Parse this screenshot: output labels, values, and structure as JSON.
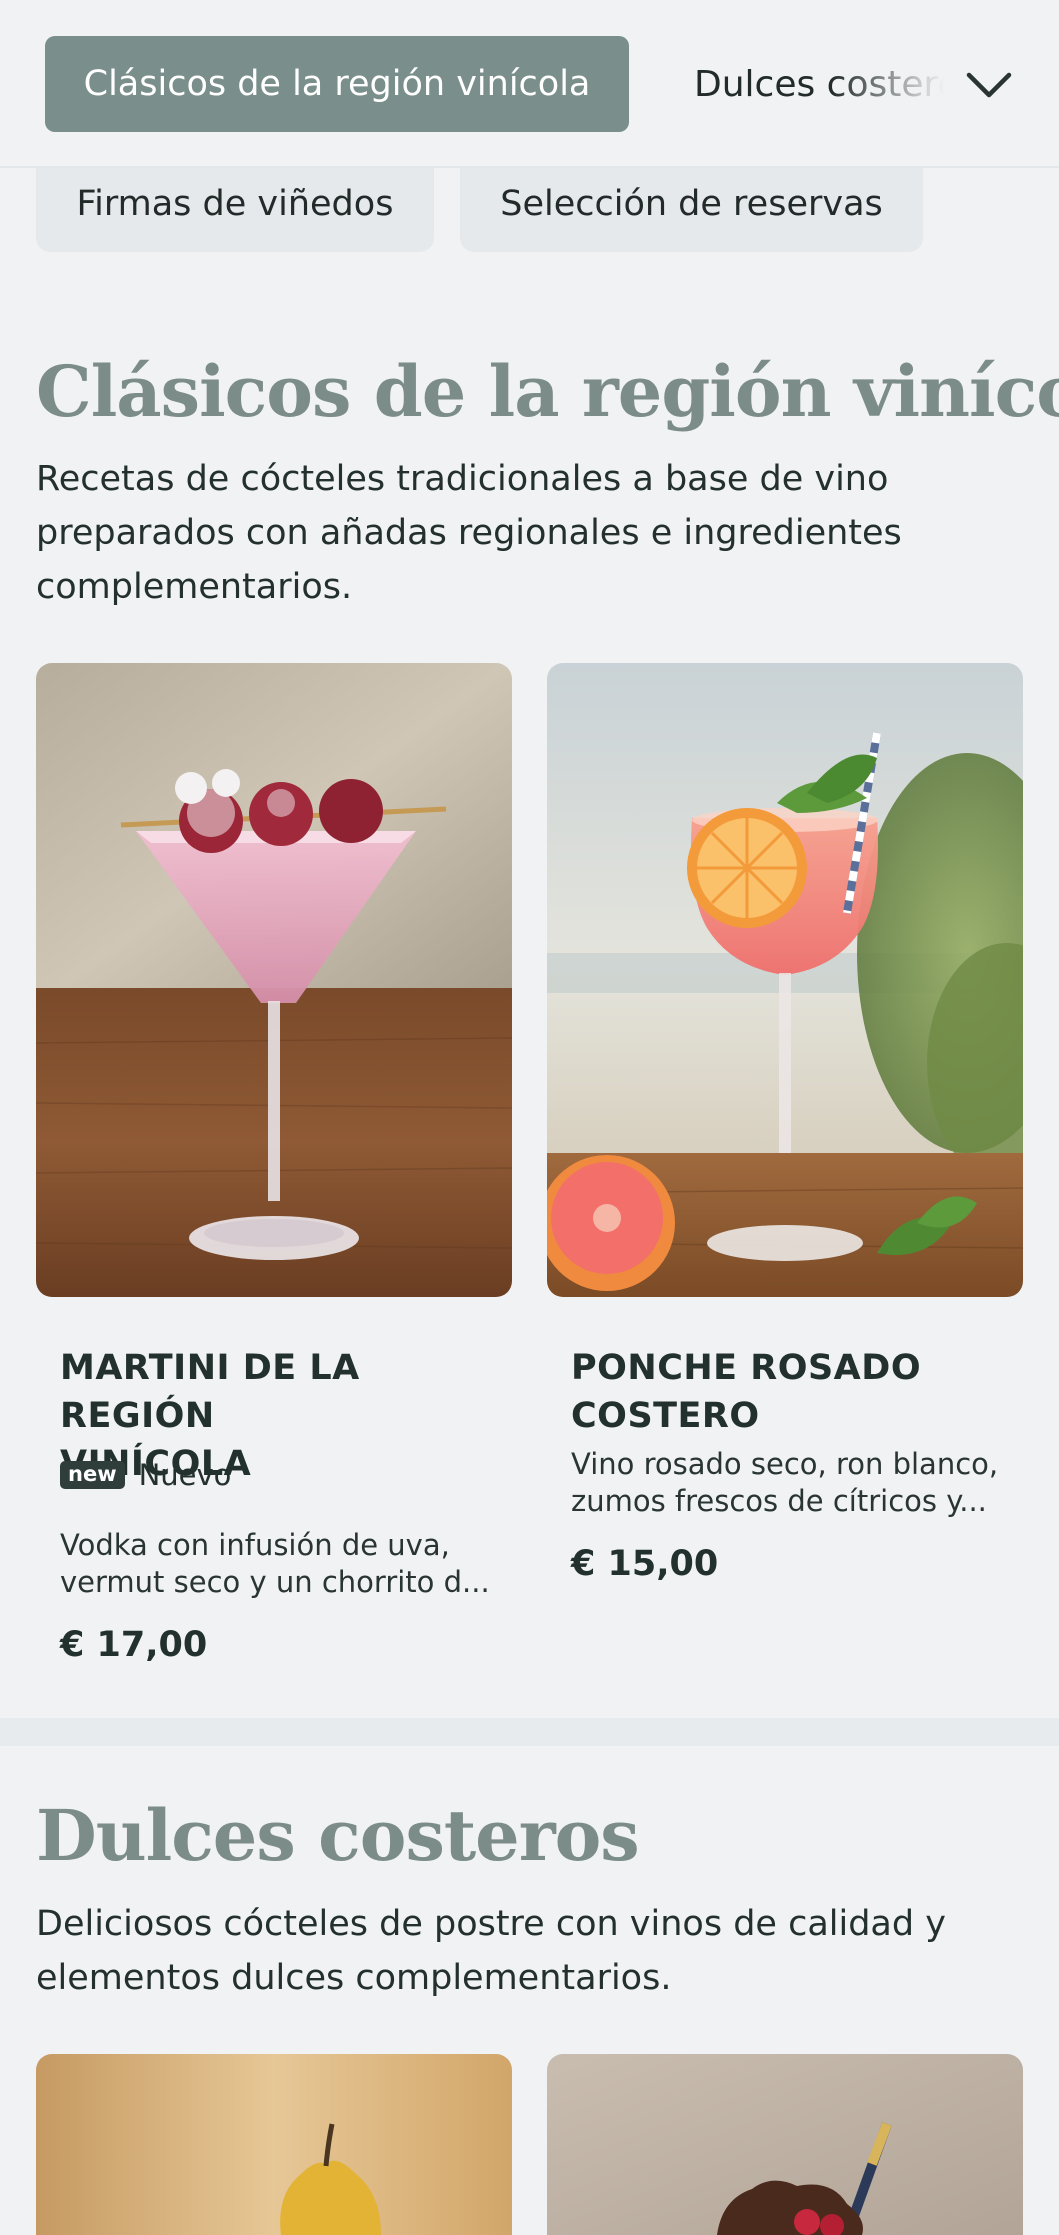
{
  "tabs": {
    "active_label": "Clásicos de la región vinícola",
    "next_label": "Dulces costeros",
    "row2": [
      "Firmas de viñedos",
      "Selección de reservas"
    ]
  },
  "sections": [
    {
      "title": "Clásicos de la región vinícola",
      "description_lines": [
        "Recetas de cócteles tradicionales a base de vino",
        "preparados con añadas regionales e ingredientes",
        "complementarios."
      ],
      "items": [
        {
          "title_lines": [
            "MARTINI DE LA REGIÓN",
            "VINÍCOLA"
          ],
          "badge": "new",
          "badge_label": "Nuevo",
          "description_lines": [
            "Vodka con infusión de uva,",
            "vermut seco y un chorrito d..."
          ],
          "price": "€ 17,00",
          "image_icon": "martini-cocktail-image"
        },
        {
          "title_lines": [
            "PONCHE ROSADO",
            "COSTERO"
          ],
          "description_lines": [
            "Vino rosado seco, ron blanco,",
            "zumos frescos de cítricos y..."
          ],
          "price": "€ 15,00",
          "image_icon": "rose-punch-cocktail-image"
        }
      ]
    },
    {
      "title": "Dulces costeros",
      "description_lines": [
        "Deliciosos cócteles de postre con vinos de calidad y",
        "elementos dulces complementarios."
      ],
      "items": [
        {
          "image_icon": "pear-dessert-cocktail-image"
        },
        {
          "image_icon": "chocolate-dessert-cocktail-image"
        }
      ]
    }
  ],
  "colors": {
    "accent": "#7a8f8b",
    "background": "#f0f2f4",
    "title": "#7b8c89"
  }
}
